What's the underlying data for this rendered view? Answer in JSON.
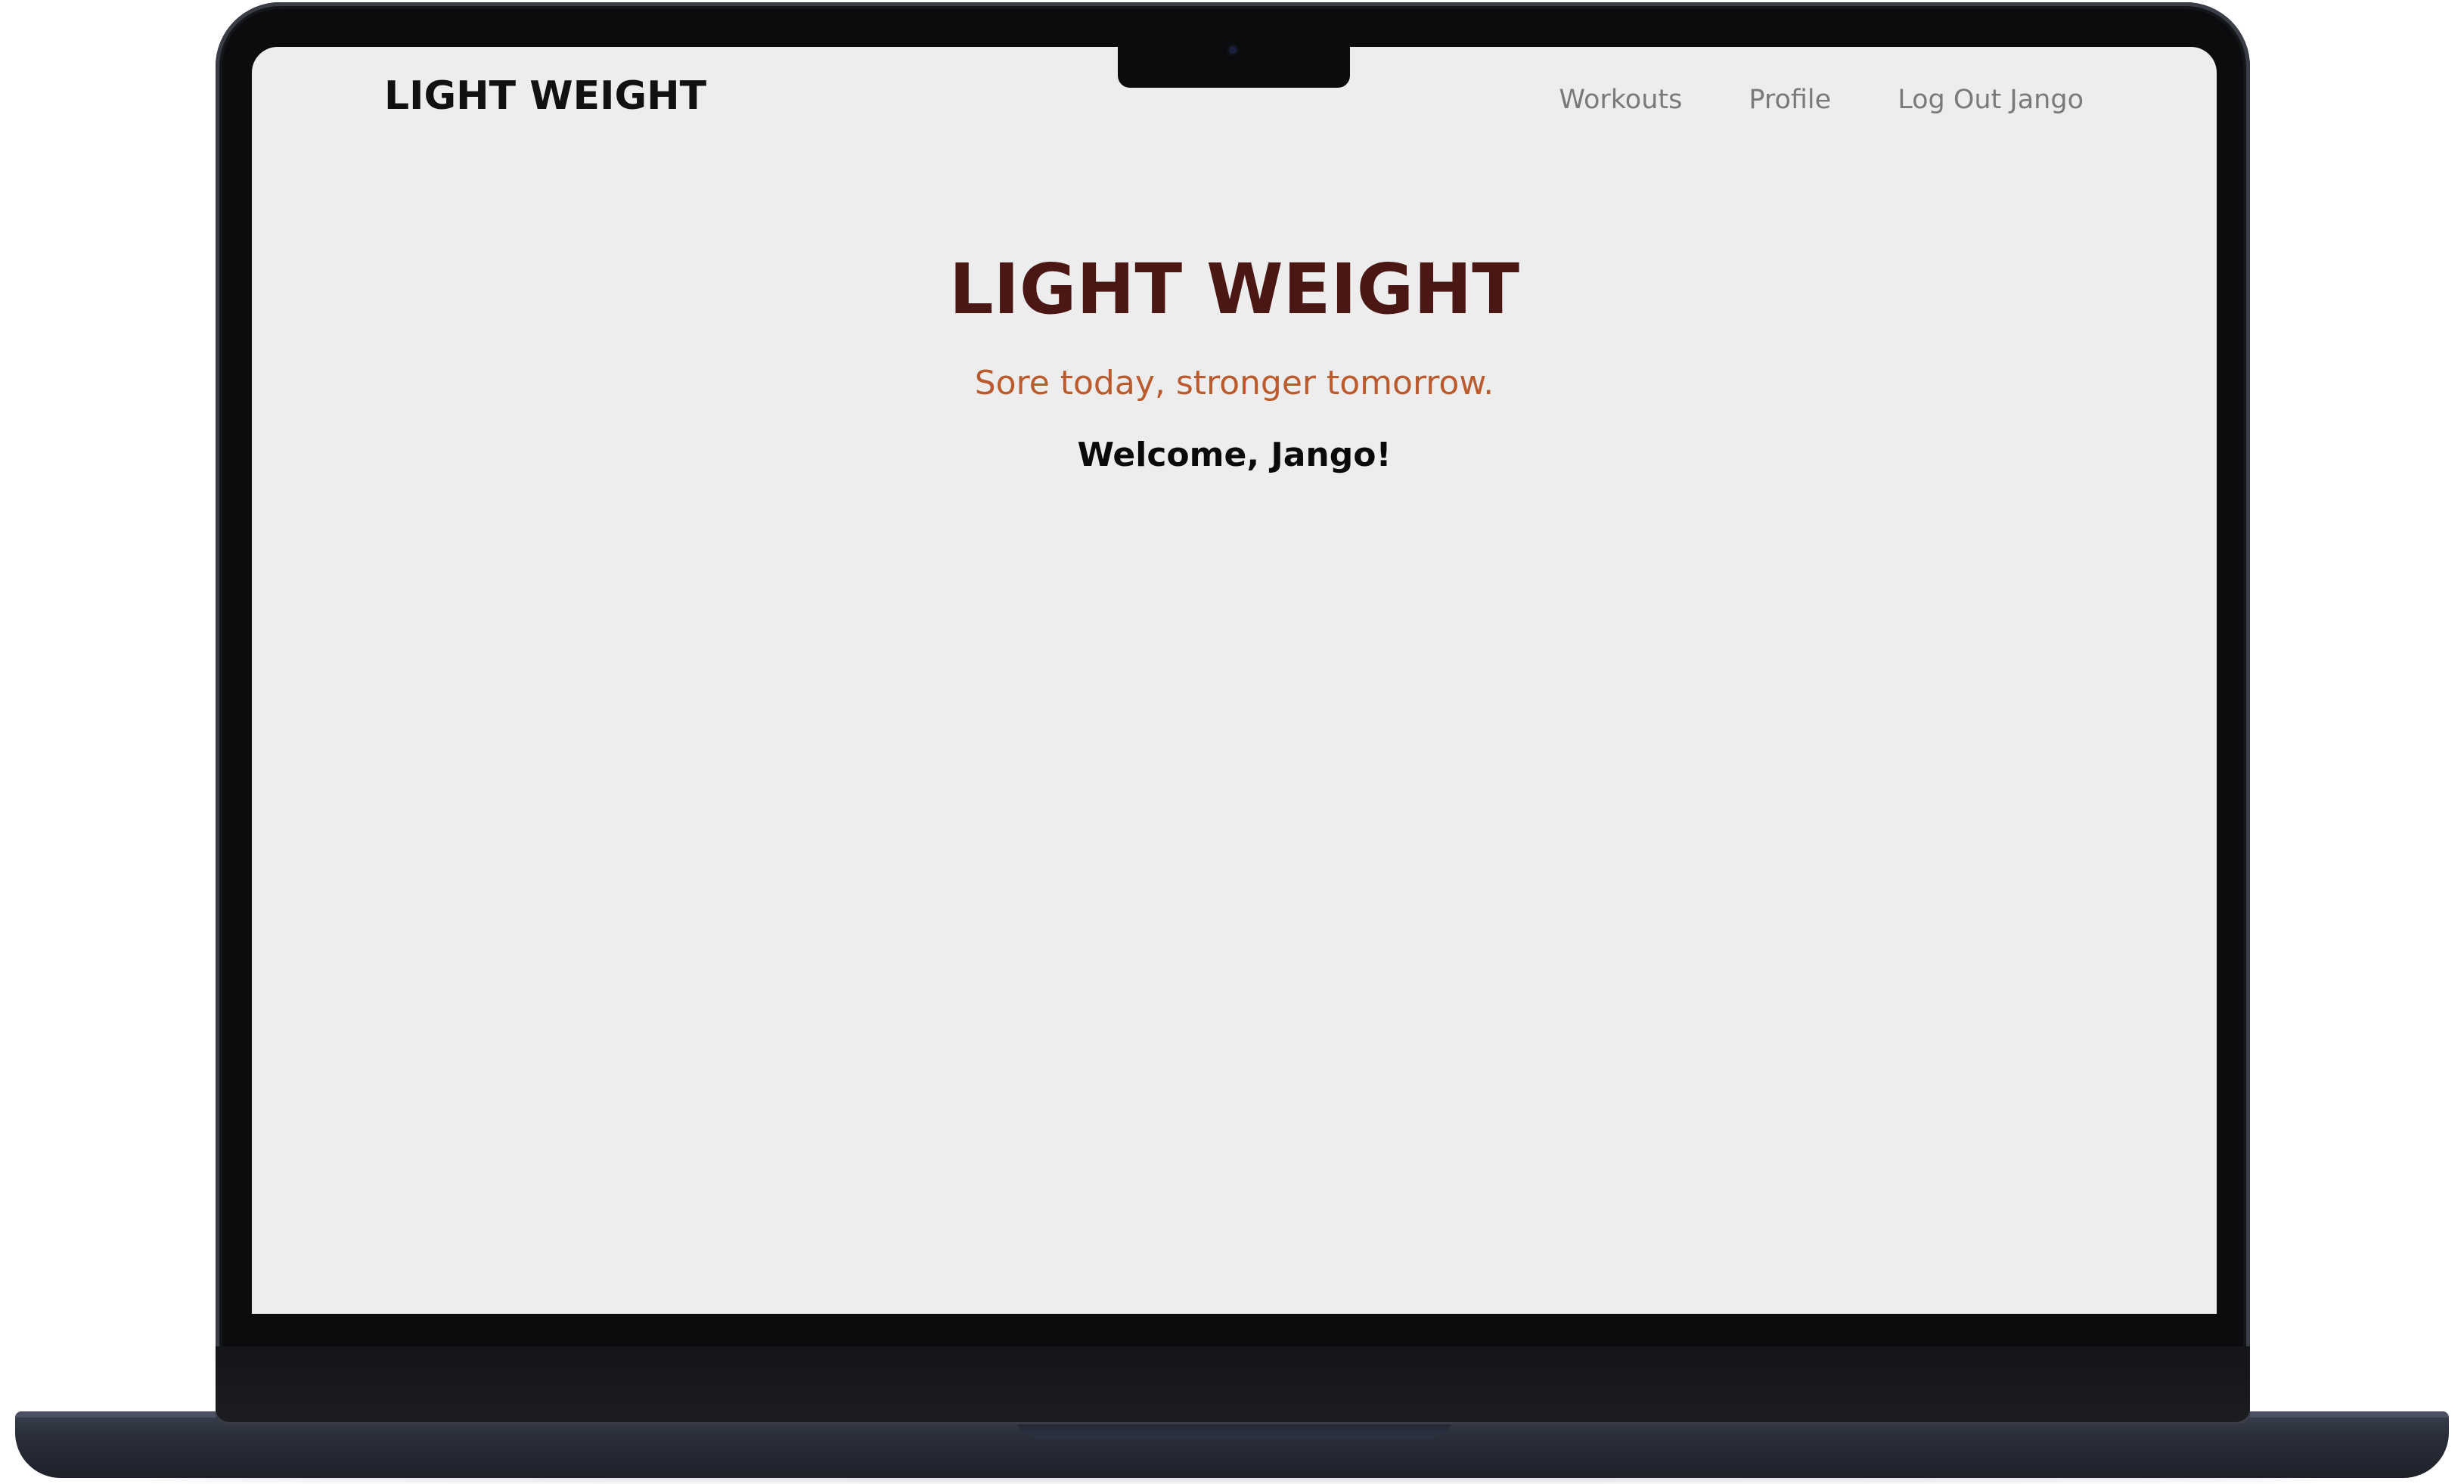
{
  "navbar": {
    "brand": "LIGHT WEIGHT",
    "links": [
      {
        "label": "Workouts"
      },
      {
        "label": "Profile"
      },
      {
        "label": "Log Out Jango"
      }
    ]
  },
  "hero": {
    "title": "LIGHT WEIGHT",
    "tagline": "Sore today, stronger tomorrow.",
    "welcome": "Welcome, Jango!"
  },
  "colors": {
    "page_background": "#ededed",
    "title": "#4a1714",
    "tagline": "#bb5a2c",
    "nav_link": "#7a7a7a",
    "device_frame": "#0b0c0e",
    "device_base": "#2a2f3a"
  }
}
